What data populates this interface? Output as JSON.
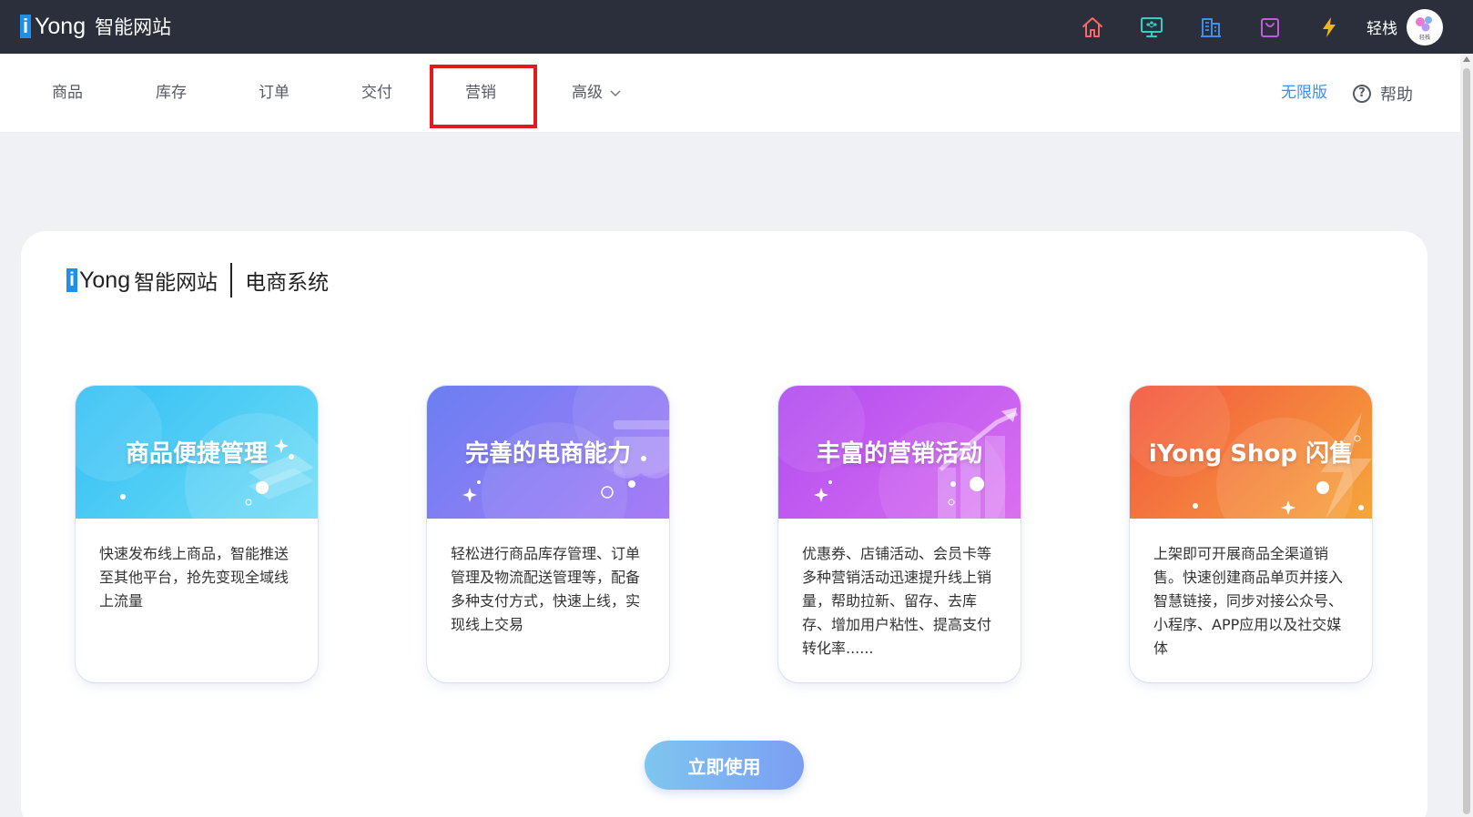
{
  "brand": {
    "i": "i",
    "yong": "Yong",
    "cn": "智能网站"
  },
  "topbar": {
    "icons": [
      "home-icon",
      "monitor-icon",
      "building-icon",
      "bag-icon",
      "lightning-icon"
    ],
    "user_name": "轻栈",
    "avatar_text": "轻栈"
  },
  "nav": {
    "items": [
      "商品",
      "库存",
      "订单",
      "交付",
      "营销",
      "高级"
    ],
    "active_index": 4,
    "limit_label": "无限版",
    "help_label": "帮助",
    "help_symbol": "?"
  },
  "panel": {
    "brand_i": "i",
    "brand_yong": "Yong",
    "brand_cn": "智能网站",
    "system_label": "电商系统",
    "cards": [
      {
        "title": "商品便捷管理",
        "body": "快速发布线上商品，智能推送至其他平台，抢先变现全域线上流量",
        "color_from": "#3dc3f5",
        "color_to": "#7ae0f5"
      },
      {
        "title": "完善的电商能力",
        "body": "轻松进行商品库存管理、订单管理及物流配送管理等，配备多种支付方式，快速上线，实现线上交易",
        "color_from": "#6a7ff2",
        "color_to": "#a27bf6"
      },
      {
        "title": "丰富的营销活动",
        "body": "优惠券、店铺活动、会员卡等多种营销活动迅速提升线上销量，帮助拉新、留存、去库存、增加用户粘性、提高支付转化率......",
        "color_from": "#b451ef",
        "color_to": "#d86cf0"
      },
      {
        "title": "iYong Shop 闪售",
        "body": "上架即可开展商品全渠道销售。快速创建商品单页并接入智慧链接，同步对接公众号、小程序、APP应用以及社交媒体",
        "color_from": "#f4603e",
        "color_to": "#f5a23b"
      }
    ],
    "cta_label": "立即使用"
  }
}
